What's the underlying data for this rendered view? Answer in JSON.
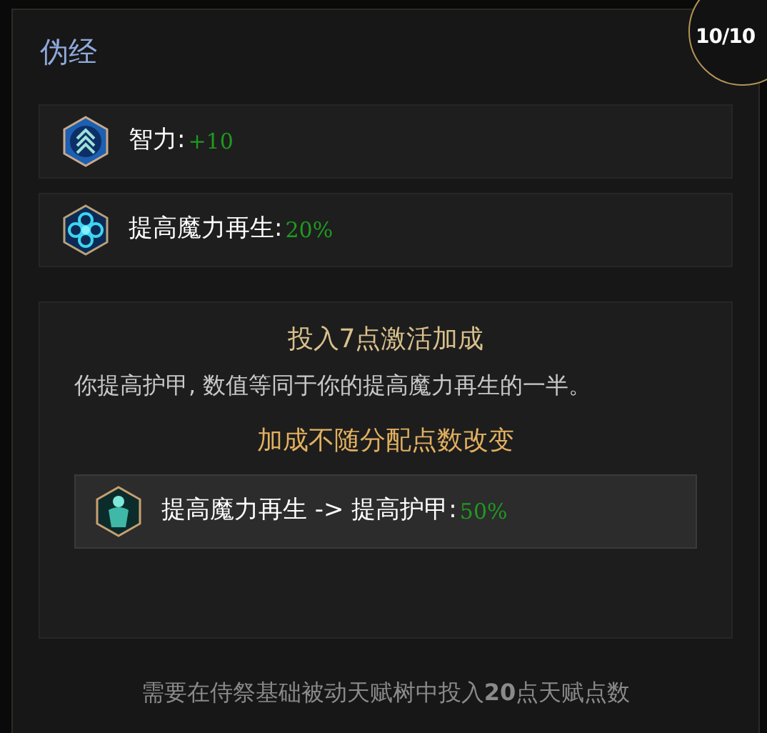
{
  "title": "伪经",
  "rank_badge": "10/10",
  "stats": [
    {
      "kind": "chevrons",
      "label": "智力:",
      "value": "+10"
    },
    {
      "kind": "flower",
      "label": "提高魔力再生:",
      "value": "20%"
    }
  ],
  "bonus": {
    "heading": "投入7点激活加成",
    "description": "你提高护甲, 数值等同于你的提高魔力再生的一半。",
    "note": "加成不随分配点数改变",
    "stat": {
      "kind": "figure",
      "label": "提高魔力再生 -> 提高护甲:",
      "value": "50%"
    }
  },
  "requirement": "需要在侍祭基础被动天赋树中投入**20**点天赋点数"
}
